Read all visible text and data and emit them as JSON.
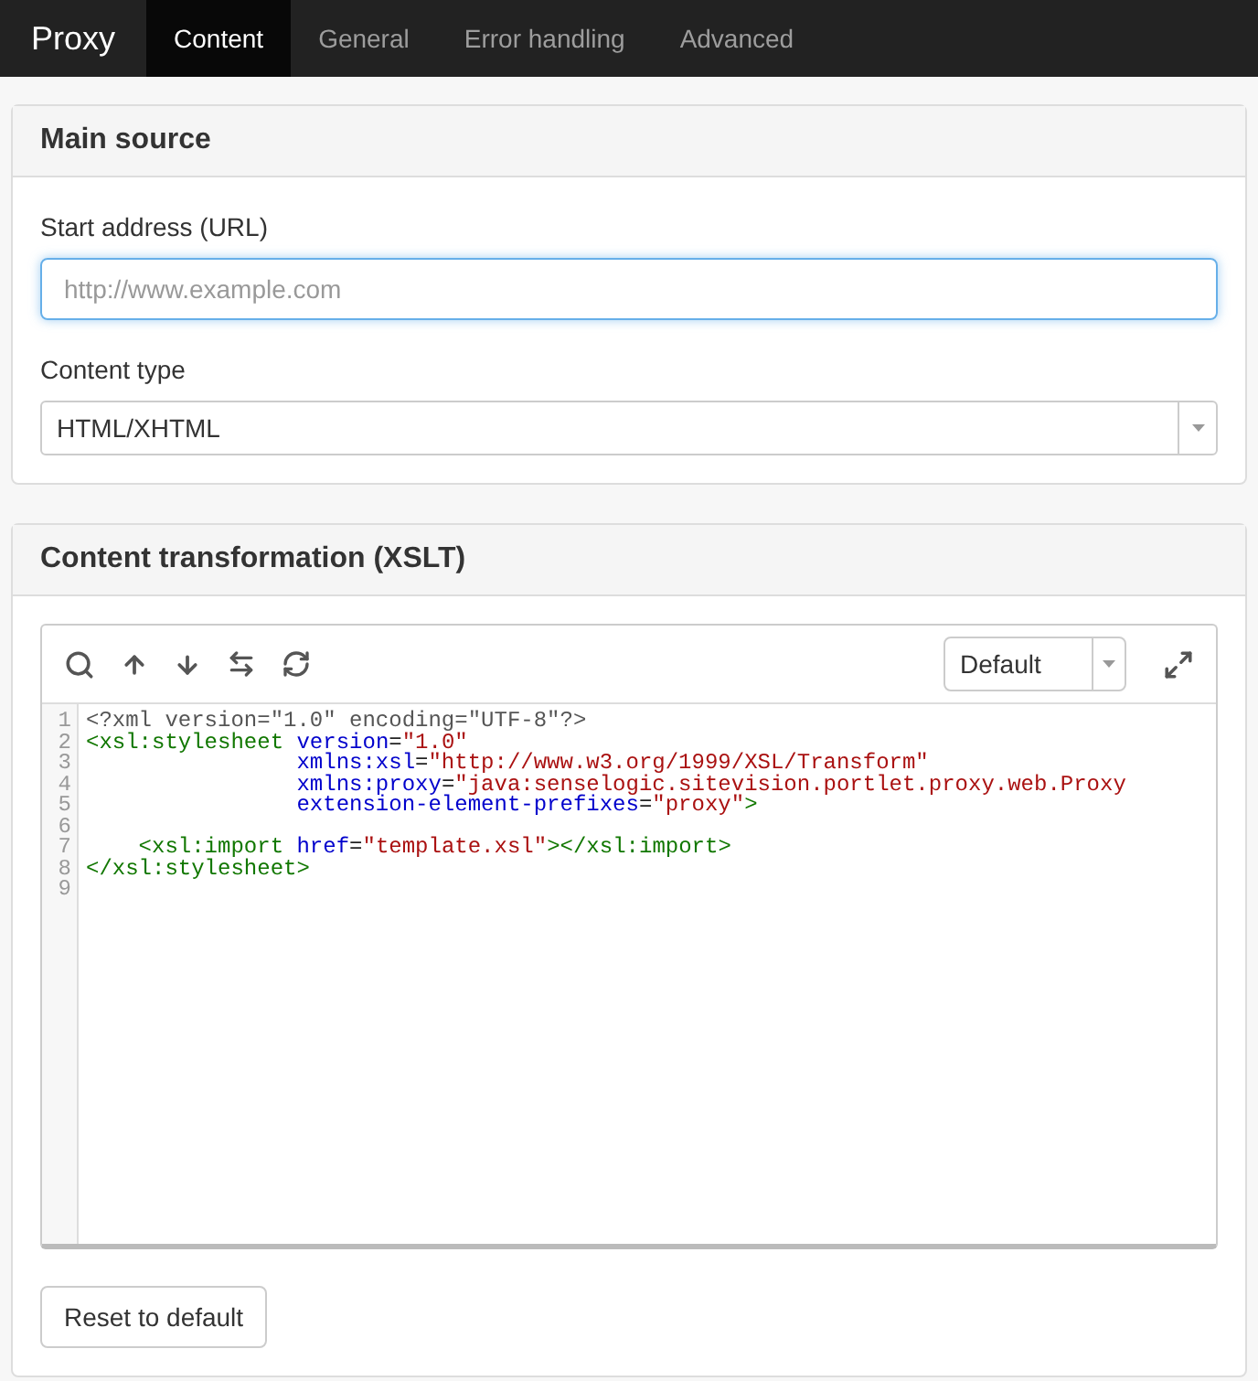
{
  "navbar": {
    "brand": "Proxy",
    "tabs": [
      {
        "label": "Content",
        "selected": true
      },
      {
        "label": "General",
        "selected": false
      },
      {
        "label": "Error handling",
        "selected": false
      },
      {
        "label": "Advanced",
        "selected": false
      }
    ]
  },
  "main_source": {
    "title": "Main source",
    "url_label": "Start address (URL)",
    "url_placeholder": "http://www.example.com",
    "content_type_label": "Content type",
    "content_type_value": "HTML/XHTML"
  },
  "transformation": {
    "title": "Content transformation (XSLT)",
    "theme_value": "Default",
    "code_lines": [
      {
        "number": "1",
        "tokens": [
          {
            "kind": "meta",
            "text": "<?xml version=\"1.0\" encoding=\"UTF-8\"?>"
          }
        ]
      },
      {
        "number": "2",
        "tokens": [
          {
            "kind": "tag",
            "text": "<xsl:stylesheet"
          },
          {
            "kind": "attr",
            "text": " version"
          },
          {
            "kind": "plain",
            "text": "="
          },
          {
            "kind": "string",
            "text": "\"1.0\""
          }
        ]
      },
      {
        "number": "3",
        "tokens": [
          {
            "kind": "attr",
            "text": "                xmlns:xsl"
          },
          {
            "kind": "plain",
            "text": "="
          },
          {
            "kind": "string",
            "text": "\"http://www.w3.org/1999/XSL/Transform\""
          }
        ]
      },
      {
        "number": "4",
        "tokens": [
          {
            "kind": "attr",
            "text": "                xmlns:proxy"
          },
          {
            "kind": "plain",
            "text": "="
          },
          {
            "kind": "string",
            "text": "\"java:senselogic.sitevision.portlet.proxy.web.Proxy"
          }
        ]
      },
      {
        "number": "5",
        "tokens": [
          {
            "kind": "attr",
            "text": "                extension-element-prefixes"
          },
          {
            "kind": "plain",
            "text": "="
          },
          {
            "kind": "string",
            "text": "\"proxy\""
          },
          {
            "kind": "tag",
            "text": ">"
          }
        ]
      },
      {
        "number": "6"
      },
      {
        "number": "7",
        "tokens": [
          {
            "kind": "tag",
            "text": "    <xsl:import"
          },
          {
            "kind": "attr",
            "text": " href"
          },
          {
            "kind": "plain",
            "text": "="
          },
          {
            "kind": "string",
            "text": "\"template.xsl\""
          },
          {
            "kind": "tag",
            "text": "></xsl:import>"
          }
        ]
      },
      {
        "number": "8",
        "tokens": [
          {
            "kind": "tag",
            "text": "</xsl:stylesheet>"
          }
        ]
      },
      {
        "number": "9"
      }
    ],
    "reset_button": "Reset to default"
  }
}
